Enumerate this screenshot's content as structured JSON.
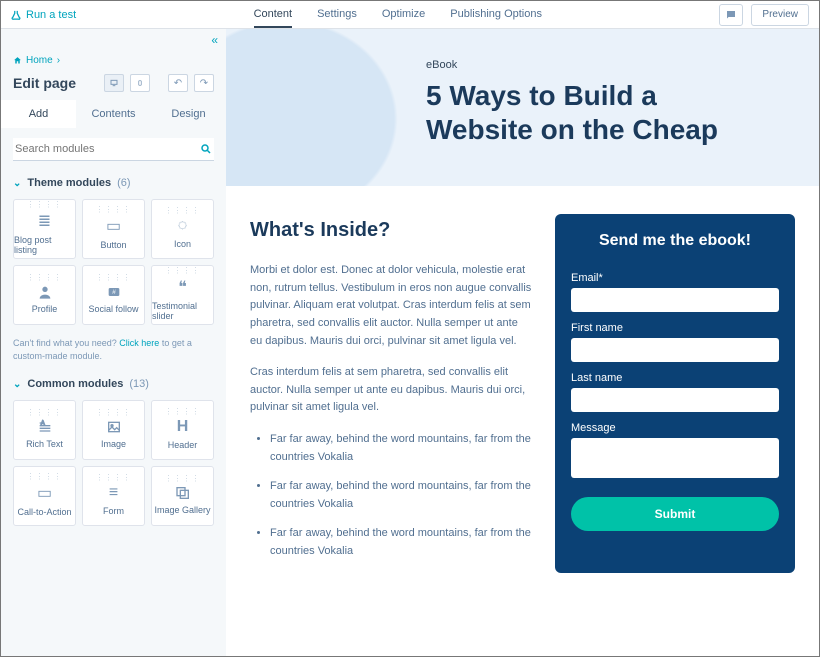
{
  "topbar": {
    "runtest": "Run a test",
    "tabs": [
      "Content",
      "Settings",
      "Optimize",
      "Publishing Options"
    ],
    "preview": "Preview"
  },
  "sidebar": {
    "breadcrumb": "Home",
    "pagetitle": "Edit page",
    "tabs": [
      "Add",
      "Contents",
      "Design"
    ],
    "search_placeholder": "Search modules",
    "theme_section": {
      "label": "Theme modules",
      "count": "(6)"
    },
    "theme_modules": [
      {
        "label": "Blog post listing"
      },
      {
        "label": "Button"
      },
      {
        "label": "Icon"
      },
      {
        "label": "Profile"
      },
      {
        "label": "Social follow"
      },
      {
        "label": "Testimonial slider"
      }
    ],
    "hint_a": "Can't find what you need? ",
    "hint_link": "Click here",
    "hint_b": " to get a custom-made module.",
    "common_section": {
      "label": "Common modules",
      "count": "(13)"
    },
    "common_modules": [
      {
        "label": "Rich Text"
      },
      {
        "label": "Image"
      },
      {
        "label": "Header"
      },
      {
        "label": "Call-to-Action"
      },
      {
        "label": "Form"
      },
      {
        "label": "Image Gallery"
      }
    ]
  },
  "page": {
    "eyebrow": "eBook",
    "title_a": "5 Ways to Build a",
    "title_b": "Website on the Cheap",
    "h2": "What's Inside?",
    "p1": "Morbi et dolor est. Donec at dolor vehicula, molestie erat non, rutrum tellus. Vestibulum in eros non augue convallis pulvinar. Aliquam erat volutpat. Cras interdum felis at sem pharetra, sed convallis elit auctor. Nulla semper ut ante eu dapibus. Mauris dui orci, pulvinar sit amet ligula vel.",
    "p2": "Cras interdum felis at sem pharetra, sed convallis elit auctor. Nulla semper ut ante eu dapibus. Mauris dui orci, pulvinar sit amet ligula vel.",
    "bullets": [
      "Far far away, behind the word mountains, far from the countries Vokalia",
      "Far far away, behind the word mountains, far from the countries Vokalia",
      "Far far away, behind the word mountains, far from the countries Vokalia"
    ],
    "form": {
      "title": "Send me the ebook!",
      "email": "Email*",
      "first": "First name",
      "last": "Last name",
      "message": "Message",
      "submit": "Submit"
    }
  }
}
